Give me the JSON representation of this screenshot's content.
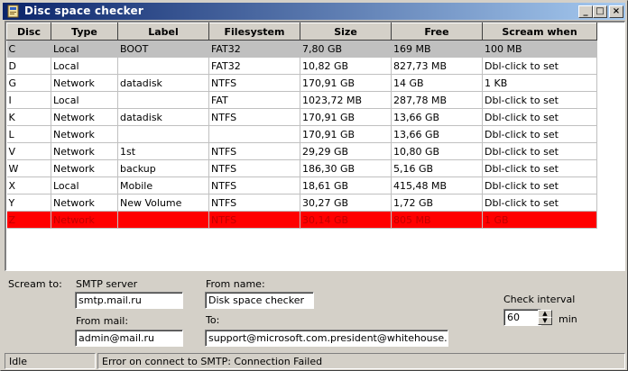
{
  "window": {
    "title": "Disc space checker"
  },
  "titlebar_buttons": {
    "minimize": "_",
    "maximize": "□",
    "close": "×"
  },
  "table": {
    "columns": [
      "Disc",
      "Type",
      "Label",
      "Filesystem",
      "Size",
      "Free",
      "Scream when"
    ],
    "rows": [
      [
        "C",
        "Local",
        "BOOT",
        "FAT32",
        "7,80 GB",
        "169 MB",
        "100 MB"
      ],
      [
        "D",
        "Local",
        "",
        "FAT32",
        "10,82 GB",
        "827,73 MB",
        "Dbl-click to set"
      ],
      [
        "G",
        "Network",
        "datadisk",
        "NTFS",
        "170,91 GB",
        "14 GB",
        "1 KB"
      ],
      [
        "I",
        "Local",
        "",
        "FAT",
        "1023,72 MB",
        "287,78 MB",
        "Dbl-click to set"
      ],
      [
        "K",
        "Network",
        "datadisk",
        "NTFS",
        "170,91 GB",
        "13,66 GB",
        "Dbl-click to set"
      ],
      [
        "L",
        "Network",
        "",
        "",
        "170,91 GB",
        "13,66 GB",
        "Dbl-click to set"
      ],
      [
        "V",
        "Network",
        "1st",
        "NTFS",
        "29,29 GB",
        "10,80 GB",
        "Dbl-click to set"
      ],
      [
        "W",
        "Network",
        "backup",
        "NTFS",
        "186,30 GB",
        "5,16 GB",
        "Dbl-click to set"
      ],
      [
        "X",
        "Local",
        "Mobile",
        "NTFS",
        "18,61 GB",
        "415,48 MB",
        "Dbl-click to set"
      ],
      [
        "Y",
        "Network",
        "New Volume",
        "NTFS",
        "30,27 GB",
        "1,72 GB",
        "Dbl-click to set"
      ],
      [
        "Z",
        "Network",
        "",
        "NTFS",
        "30,14 GB",
        "805 MB",
        "1 GB"
      ]
    ],
    "selected_row": "C",
    "alert_row": "Z",
    "alert_color": "#ff0000"
  },
  "scream": {
    "label": "Scream to:",
    "smtp_server_label": "SMTP server",
    "smtp_server_value": "smtp.mail.ru",
    "from_mail_label": "From mail:",
    "from_mail_value": "admin@mail.ru",
    "from_name_label": "From name:",
    "from_name_value": "Disk space checker",
    "to_label": "To:",
    "to_value": "support@microsoft.com.president@whitehouse.gov",
    "check_interval_label": "Check interval",
    "check_interval_value": "60",
    "check_interval_unit": "min"
  },
  "status": {
    "state": "Idle",
    "message": "Error on connect to SMTP: Connection Failed"
  }
}
